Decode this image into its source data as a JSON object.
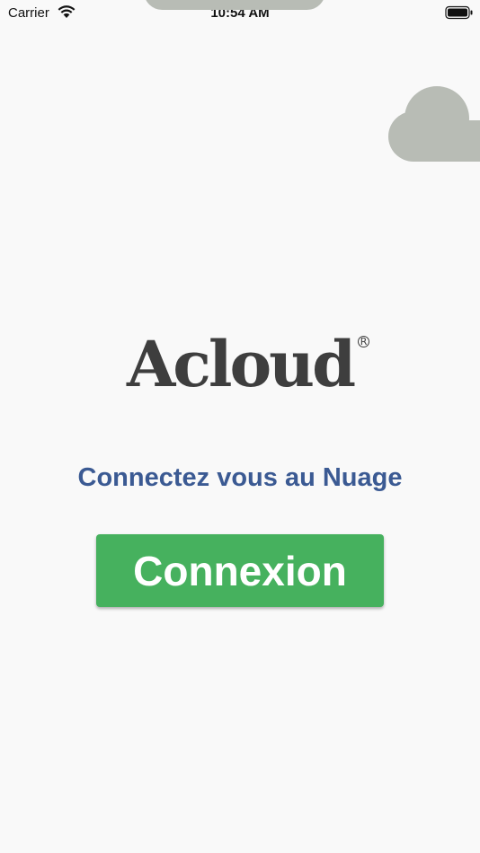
{
  "status_bar": {
    "carrier": "Carrier",
    "time": "10:54 AM",
    "wifi_icon": "wifi-icon",
    "battery_icon": "battery-icon"
  },
  "decoration": {
    "cloud_icon": "cloud-icon",
    "cloud_color": "#b8bcb5"
  },
  "logo": {
    "text": "Acloud",
    "registered_mark": "R",
    "color": "#3e3e3e"
  },
  "tagline": "Connectez vous au Nuage",
  "tagline_color": "#3b5a93",
  "login_button": {
    "label": "Connexion",
    "color": "#46b15e"
  }
}
